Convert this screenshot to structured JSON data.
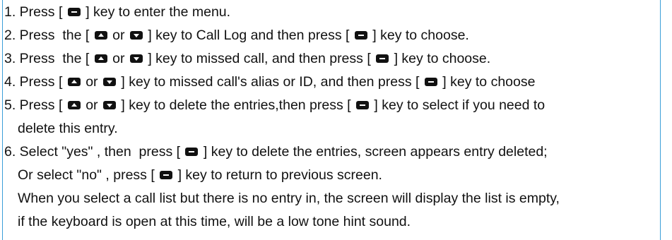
{
  "lines": [
    {
      "segments": [
        "1. Press [ ",
        " ] key to enter the menu."
      ]
    },
    {
      "segments": [
        "2. Press  the [ ",
        " or ",
        " ] key to Call Log and then press [ ",
        " ] key to choose."
      ]
    },
    {
      "segments": [
        "3. Press  the [ ",
        " or ",
        " ] key to missed call, and then press [ ",
        " ] key to choose."
      ]
    },
    {
      "segments": [
        "4. Press [ ",
        " or ",
        " ] key to missed call's alias or ID, and then press [ ",
        " ] key to choose"
      ]
    },
    {
      "segments": [
        "5. Press [ ",
        " or ",
        " ] key to delete the entries,then press [ ",
        " ] key to select if you need to"
      ]
    },
    {
      "segments": [
        "delete this entry."
      ]
    },
    {
      "segments": [
        "6. Select \"yes\" , then  press [ ",
        " ] key to delete the entries, screen appears entry deleted;"
      ]
    },
    {
      "segments": [
        "Or select \"no\" , press [ ",
        " ] key to return to previous screen."
      ]
    },
    {
      "segments": [
        "When you select a call list but there is no entry in, the screen will display the list is empty,"
      ]
    },
    {
      "segments": [
        "if the keyboard is open at this time, will be a low tone hint sound."
      ]
    }
  ],
  "icons": {
    "menu_key": "menu-key-icon",
    "up_key": "up-arrow-key-icon",
    "down_key": "down-arrow-key-icon"
  },
  "colors": {
    "text": "#111111",
    "key_fill": "#111111",
    "margin_rule": "#3b9fd8"
  }
}
